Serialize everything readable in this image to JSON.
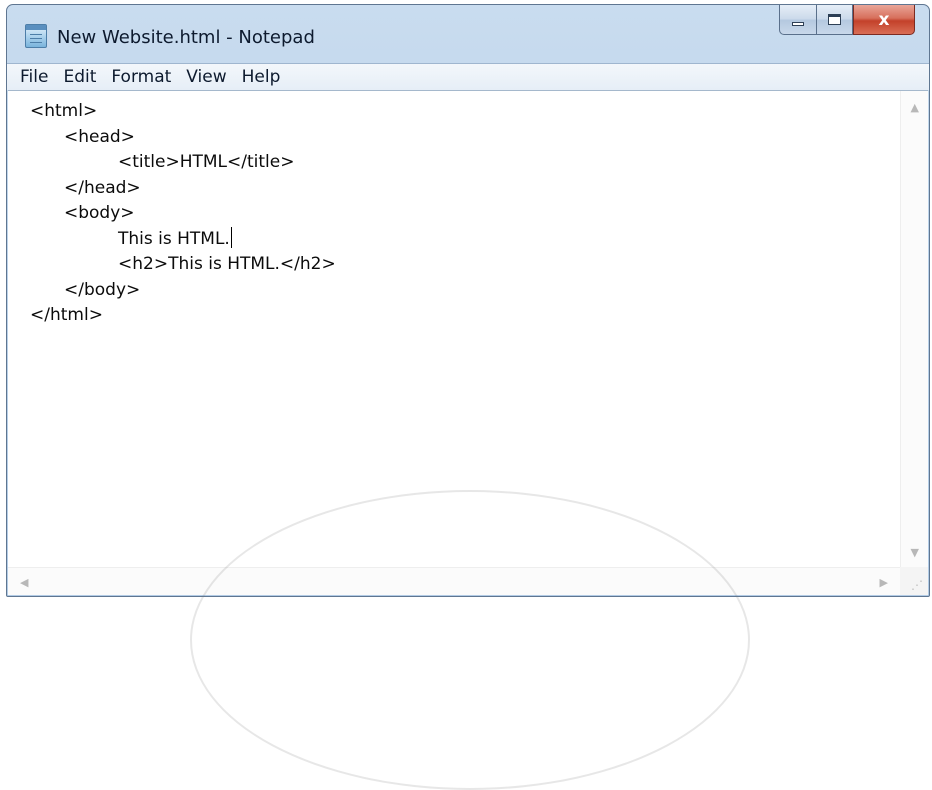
{
  "window": {
    "title": "New Website.html - Notepad",
    "close_glyph": "x"
  },
  "menu": [
    "File",
    "Edit",
    "Format",
    "View",
    "Help"
  ],
  "document": {
    "lines": [
      {
        "indent": 0,
        "text": "<html>"
      },
      {
        "indent": 1,
        "text": "<head>"
      },
      {
        "indent": 2,
        "text": "<title>HTML</title>"
      },
      {
        "indent": 1,
        "text": "</head>"
      },
      {
        "indent": 1,
        "text": "<body>"
      },
      {
        "indent": 2,
        "text": "This is HTML.",
        "caret": true
      },
      {
        "indent": 2,
        "text": "<h2>This is HTML.</h2>"
      },
      {
        "indent": 1,
        "text": "</body>"
      },
      {
        "indent": 0,
        "text": "</html>"
      }
    ]
  },
  "icons": {
    "app": "notepad-icon",
    "minimize": "minimize-icon",
    "maximize": "maximize-icon",
    "close": "close-icon"
  }
}
